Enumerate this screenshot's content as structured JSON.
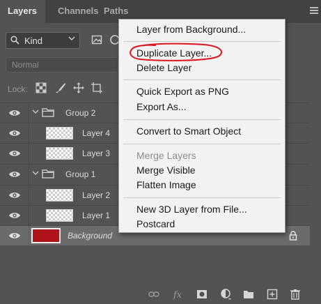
{
  "tabs": [
    {
      "label": "Layers",
      "active": true
    },
    {
      "label": "Channels",
      "active": false
    },
    {
      "label": "Paths",
      "active": false
    }
  ],
  "filter": {
    "kind_label": "Kind"
  },
  "blend_mode": "Normal",
  "lock_label": "Lock:",
  "layers": [
    {
      "name": "Group 2",
      "type": "group"
    },
    {
      "name": "Layer 4",
      "type": "layer"
    },
    {
      "name": "Layer 3",
      "type": "layer"
    },
    {
      "name": "Group 1",
      "type": "group"
    },
    {
      "name": "Layer 2",
      "type": "layer"
    },
    {
      "name": "Layer 1",
      "type": "layer"
    },
    {
      "name": "Background",
      "type": "background"
    }
  ],
  "context_menu": {
    "items": [
      {
        "label": "Layer from Background...",
        "enabled": true
      },
      {
        "label": "Duplicate Layer...",
        "enabled": true,
        "circled": true
      },
      {
        "label": "Delete Layer",
        "enabled": true
      },
      {
        "label": "Quick Export as PNG",
        "enabled": true
      },
      {
        "label": "Export As...",
        "enabled": true
      },
      {
        "label": "Convert to Smart Object",
        "enabled": true
      },
      {
        "label": "Merge Layers",
        "enabled": false
      },
      {
        "label": "Merge Visible",
        "enabled": true
      },
      {
        "label": "Flatten Image",
        "enabled": true
      },
      {
        "label": "New 3D Layer from File...",
        "enabled": true
      },
      {
        "label": "Postcard",
        "enabled": true
      }
    ]
  },
  "colors": {
    "panel_bg": "#535353",
    "tabbar_bg": "#424242",
    "menu_bg": "#f2f2f2",
    "background_swatch": "#b0141b",
    "annotation": "#e0141e"
  }
}
